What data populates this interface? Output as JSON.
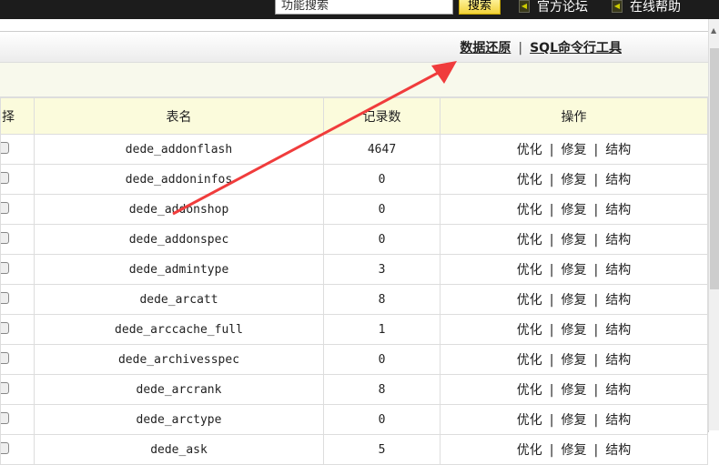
{
  "topbar": {
    "search_placeholder": "功能搜索",
    "search_button": "搜索",
    "links": [
      "官方论坛",
      "在线帮助"
    ]
  },
  "panel": {
    "links": [
      "数据还原",
      "SQL命令行工具"
    ],
    "separator": "|"
  },
  "table": {
    "headers": [
      "择",
      "表名",
      "记录数",
      "操作"
    ],
    "ops": [
      "优化",
      "修复",
      "结构"
    ],
    "op_sep": "|",
    "rows": [
      {
        "name": "dede_addonflash",
        "count": "4647"
      },
      {
        "name": "dede_addoninfos",
        "count": "0"
      },
      {
        "name": "dede_addonshop",
        "count": "0"
      },
      {
        "name": "dede_addonspec",
        "count": "0"
      },
      {
        "name": "dede_admintype",
        "count": "3"
      },
      {
        "name": "dede_arcatt",
        "count": "8"
      },
      {
        "name": "dede_arccache_full",
        "count": "1"
      },
      {
        "name": "dede_archivesspec",
        "count": "0"
      },
      {
        "name": "dede_arcrank",
        "count": "8"
      },
      {
        "name": "dede_arctype",
        "count": "0"
      },
      {
        "name": "dede_ask",
        "count": "5"
      }
    ]
  },
  "colors": {
    "annotation_arrow": "#f03c3c",
    "topbar": "#1c1c1c"
  }
}
